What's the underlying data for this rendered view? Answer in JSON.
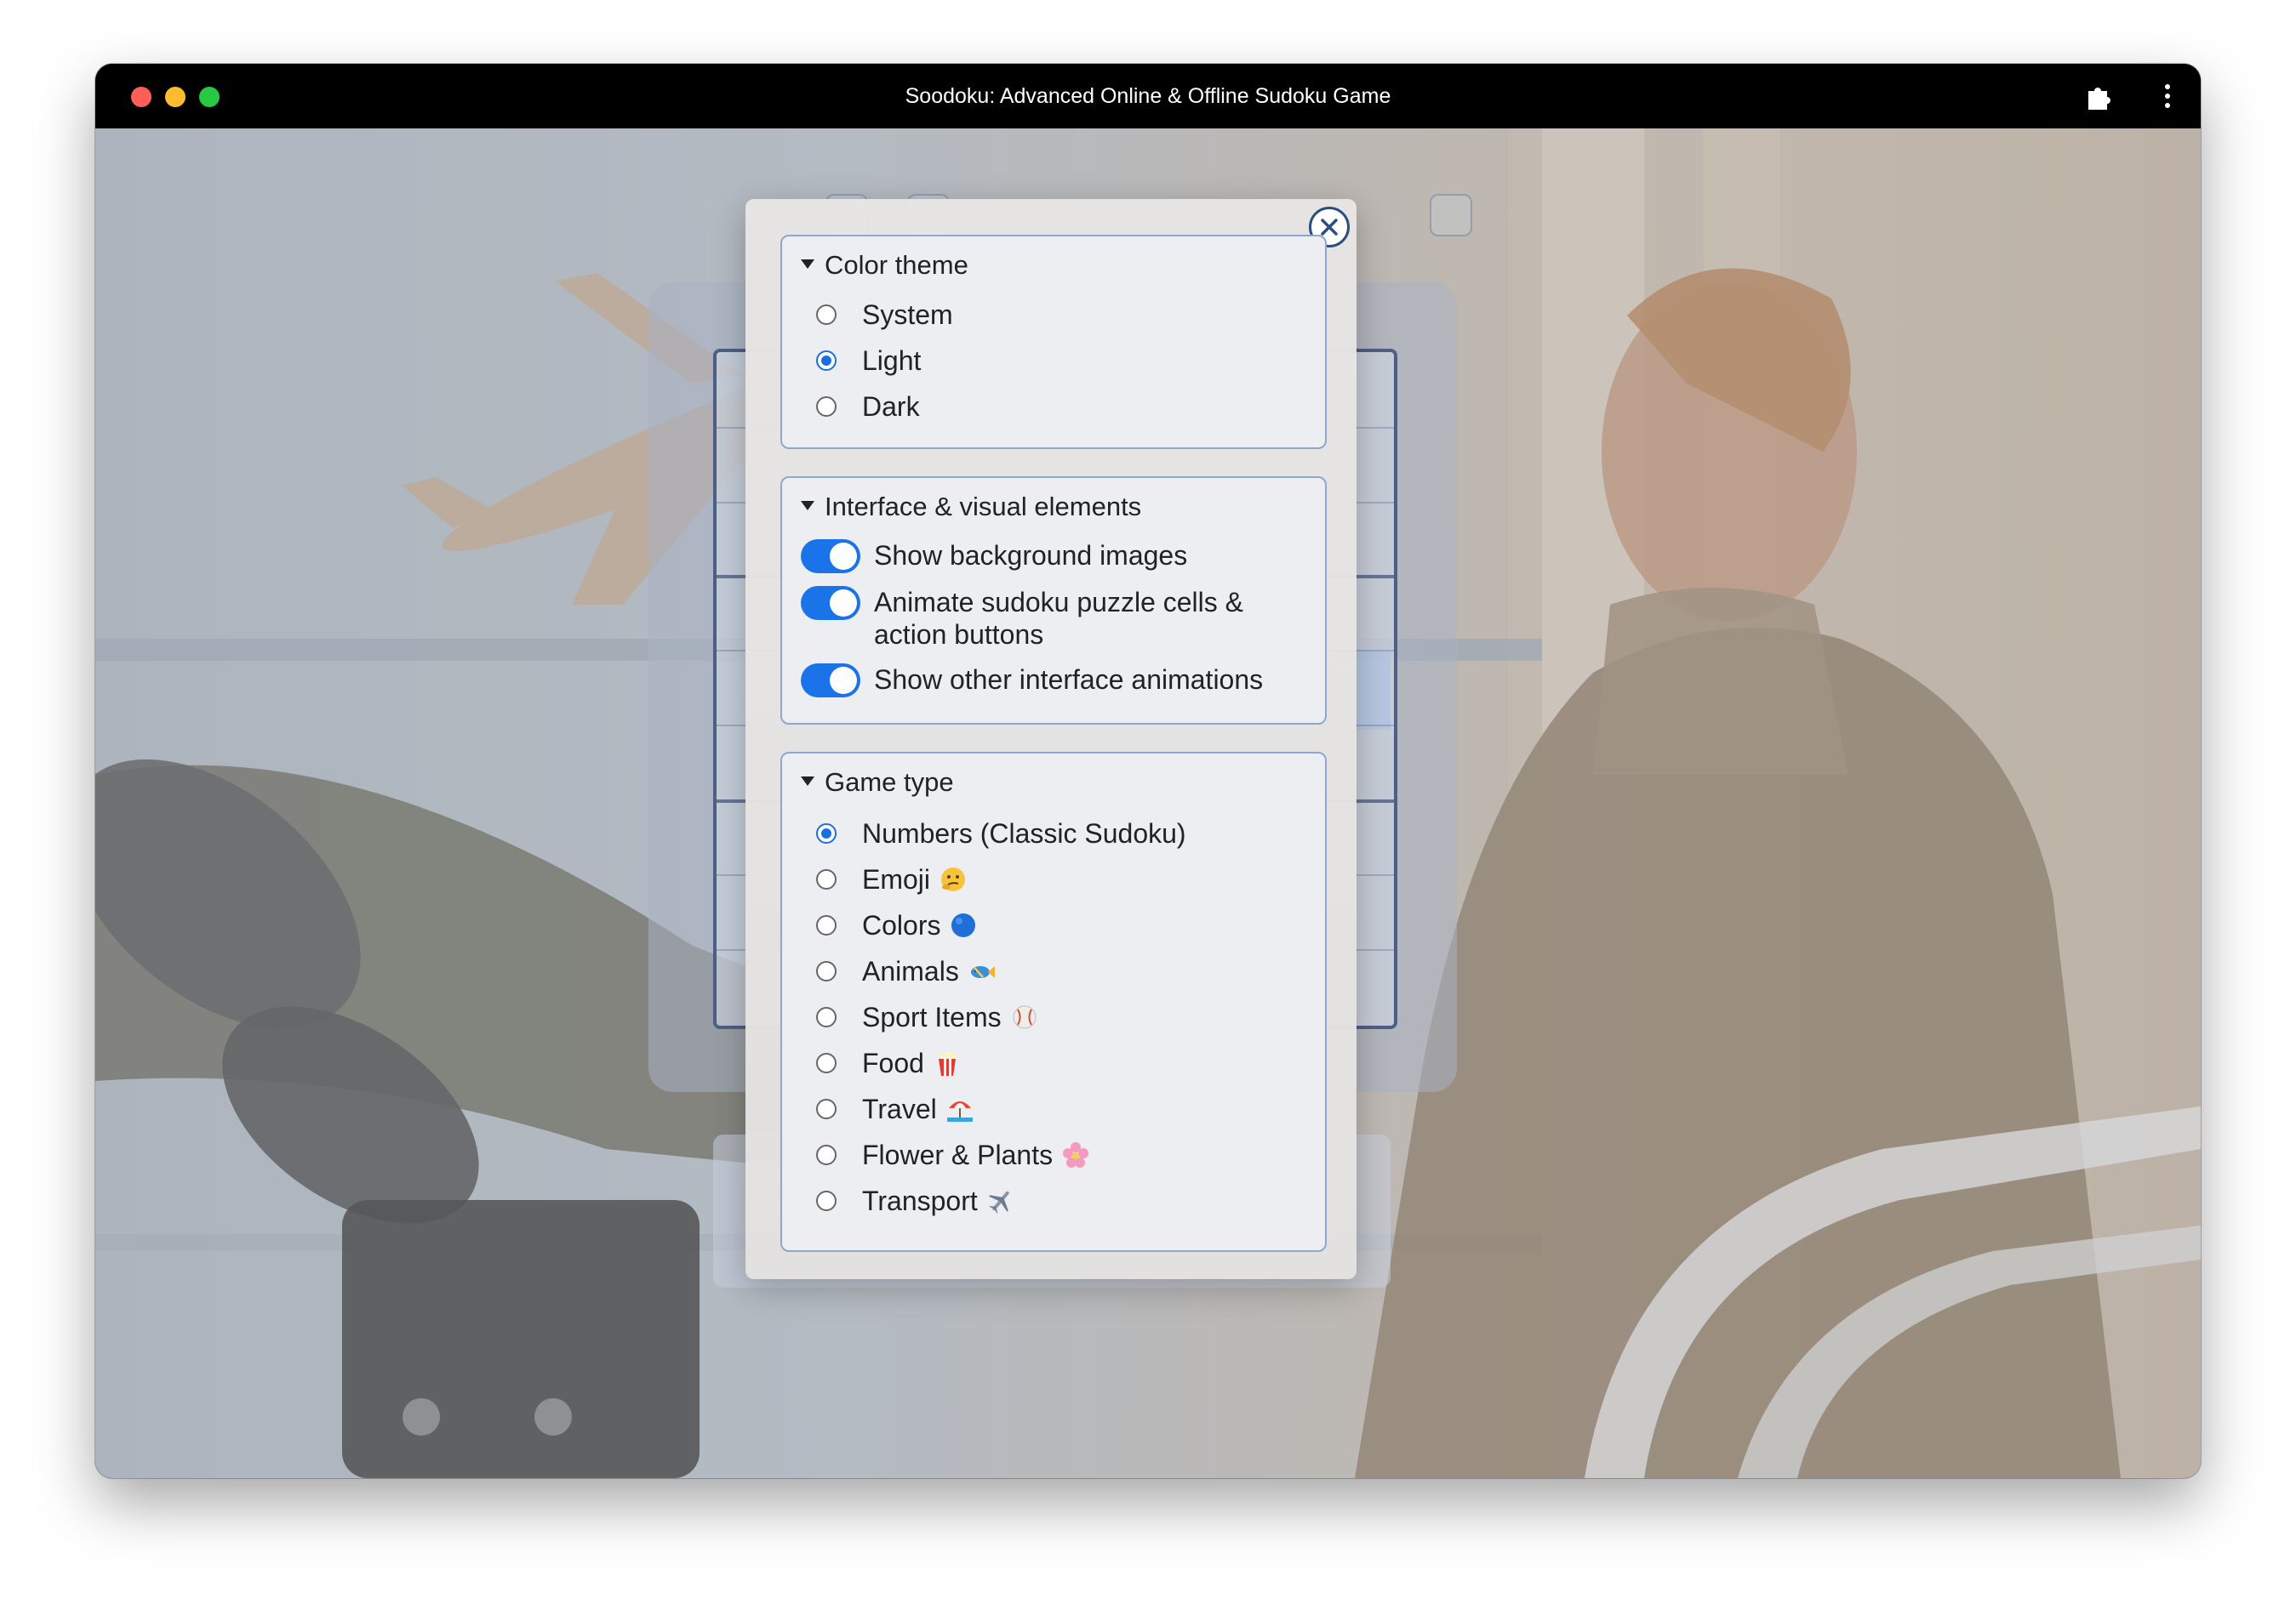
{
  "window": {
    "title": "Soodoku: Advanced Online & Offline Sudoku Game",
    "toolbar_icons": [
      "puzzle-extension-icon",
      "kebab-menu-icon"
    ]
  },
  "settings_modal": {
    "close_icon": "close-icon",
    "color_theme": {
      "legend": "Color theme",
      "options": [
        "System",
        "Light",
        "Dark"
      ],
      "selected": "Light"
    },
    "interface": {
      "legend": "Interface & visual elements",
      "toggles": [
        {
          "line1": "Show background images",
          "line2": "",
          "on": true
        },
        {
          "line1": "Animate sudoku puzzle cells &",
          "line2": "action buttons",
          "on": true
        },
        {
          "line1": "Show other interface animations",
          "line2": "",
          "on": true
        }
      ]
    },
    "game_type": {
      "legend": "Game type",
      "options": [
        {
          "label": "Numbers (Classic Sudoku)",
          "emoji": ""
        },
        {
          "label": "Emoji",
          "emoji": "thinking-face-icon"
        },
        {
          "label": "Colors",
          "emoji": "blue-circle-icon"
        },
        {
          "label": "Animals",
          "emoji": "fish-icon"
        },
        {
          "label": "Sport Items",
          "emoji": "baseball-icon"
        },
        {
          "label": "Food",
          "emoji": "popcorn-icon"
        },
        {
          "label": "Travel",
          "emoji": "beach-umbrella-icon"
        },
        {
          "label": "Flower & Plants",
          "emoji": "cherry-blossom-icon"
        },
        {
          "label": "Transport",
          "emoji": "airplane-icon"
        }
      ],
      "selected": "Numbers (Classic Sudoku)"
    }
  },
  "colors": {
    "accent": "#1a73e8",
    "fieldset_border": "#8da7cf",
    "close_border": "#2a4e80"
  }
}
